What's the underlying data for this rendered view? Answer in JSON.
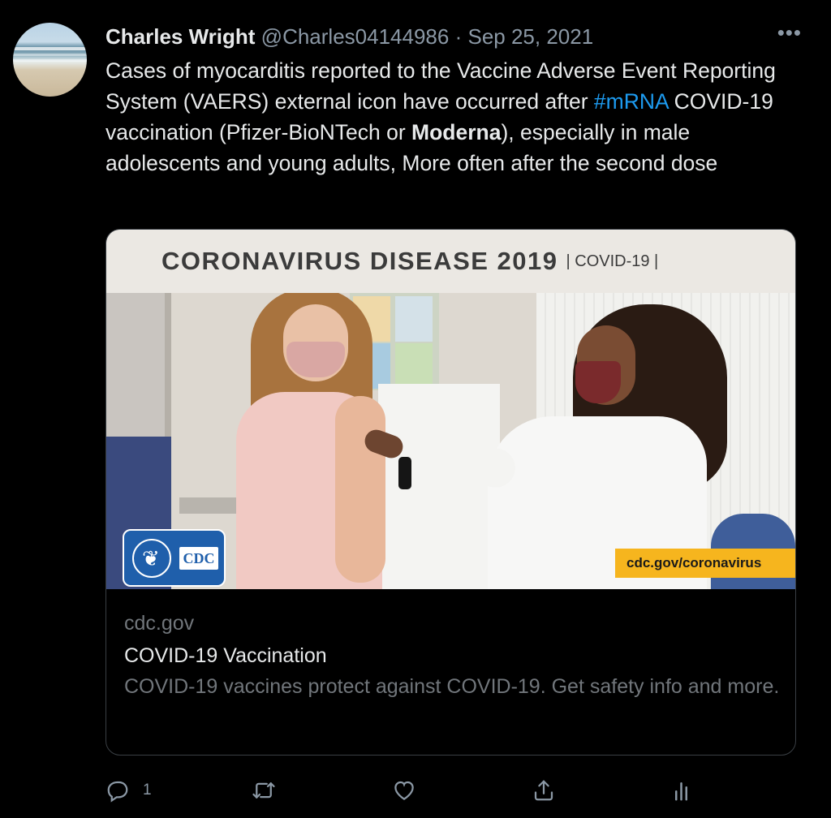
{
  "author": {
    "name": "Charles Wright",
    "handle": "@Charles04144986",
    "separator": "·",
    "date": "Sep 25, 2021"
  },
  "more_label": "•••",
  "tweet": {
    "text_part1": "Cases of myocarditis reported to the Vaccine Adverse Event Reporting System (VAERS) external icon have occurred after ",
    "hashtag": "#mRNA",
    "text_part2": " COVID-19 vaccination (Pfizer-BioNTech or ",
    "bold_word": "Moderna",
    "text_part3": "), especially in male adolescents and young adults, More often after the second dose"
  },
  "card": {
    "image": {
      "banner_title": "CORONAVIRUS DISEASE 2019",
      "banner_sub": "| COVID-19 |",
      "logo_text": "CDC",
      "url_banner": "cdc.gov/coronavirus"
    },
    "domain": "cdc.gov",
    "title": "COVID-19 Vaccination",
    "description": "COVID-19 vaccines protect against COVID-19. Get safety info and more."
  },
  "actions": {
    "reply_count": "1",
    "retweet_count": "",
    "like_count": ""
  },
  "colors": {
    "background": "#000000",
    "text": "#e7e9ea",
    "secondary": "#8b98a5",
    "link": "#1d9bf0"
  },
  "icons": [
    "reply-icon",
    "retweet-icon",
    "like-icon",
    "share-icon",
    "analytics-icon",
    "more-icon"
  ]
}
